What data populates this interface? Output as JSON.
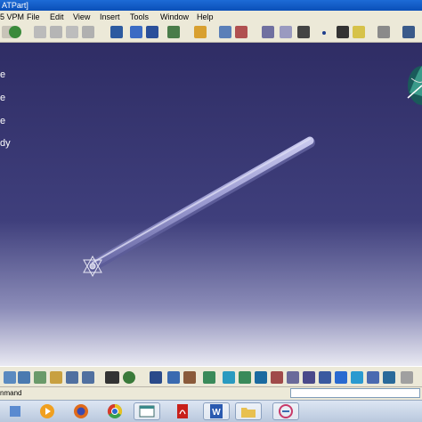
{
  "window": {
    "title": "ATPart]",
    "title_bg": "#0a4fb8"
  },
  "menu": {
    "items": [
      {
        "label": "5 VPM"
      },
      {
        "label": "File"
      },
      {
        "label": "Edit"
      },
      {
        "label": "View"
      },
      {
        "label": "Insert"
      },
      {
        "label": "Tools"
      },
      {
        "label": "Window"
      },
      {
        "label": "Help"
      }
    ]
  },
  "tree": {
    "items": [
      {
        "label": "e"
      },
      {
        "label": "e"
      },
      {
        "label": "e"
      },
      {
        "label": "dy"
      }
    ]
  },
  "viewport": {
    "bg_top": "#2f2d65",
    "bg_bottom": "#e9e9f2",
    "part_color": "#9a9ad0"
  },
  "command": {
    "label": "nmand",
    "placeholder": ""
  },
  "taskbar": {
    "apps": [
      {
        "icon": "media-player-icon"
      },
      {
        "icon": "firefox-icon"
      },
      {
        "icon": "chrome-icon"
      },
      {
        "icon": "window-icon"
      },
      {
        "icon": "acrobat-icon"
      },
      {
        "icon": "word-icon"
      },
      {
        "icon": "folder-icon"
      },
      {
        "icon": "catia-icon"
      }
    ]
  }
}
